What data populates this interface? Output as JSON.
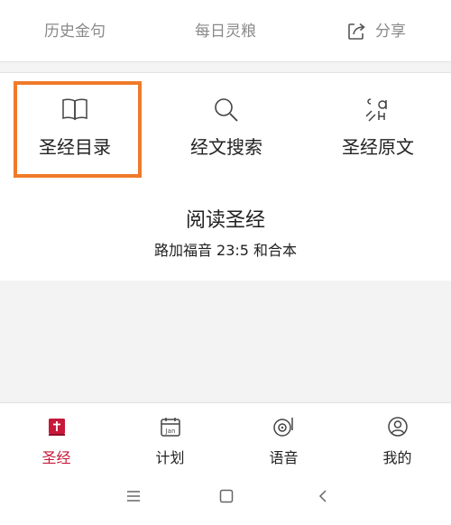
{
  "topbar": {
    "history": "历史金句",
    "daily": "每日灵粮",
    "share": "分享",
    "share_icon": "share-icon"
  },
  "features": [
    {
      "label": "圣经目录",
      "icon": "book-icon"
    },
    {
      "label": "经文搜索",
      "icon": "search-icon"
    },
    {
      "label": "圣经原文",
      "icon": "original-text-icon"
    }
  ],
  "reading": {
    "title": "阅读圣经",
    "subtitle": "路加福音 23:5 和合本"
  },
  "tabs": [
    {
      "label": "圣经",
      "icon": "bible-icon",
      "active": true
    },
    {
      "label": "计划",
      "icon": "calendar-icon",
      "icon_text": "Jan"
    },
    {
      "label": "语音",
      "icon": "audio-icon"
    },
    {
      "label": "我的",
      "icon": "profile-icon"
    }
  ],
  "colors": {
    "accent": "#c7183a",
    "highlight": "#f07a2a",
    "text": "#222222",
    "muted": "#8a8a8a"
  }
}
